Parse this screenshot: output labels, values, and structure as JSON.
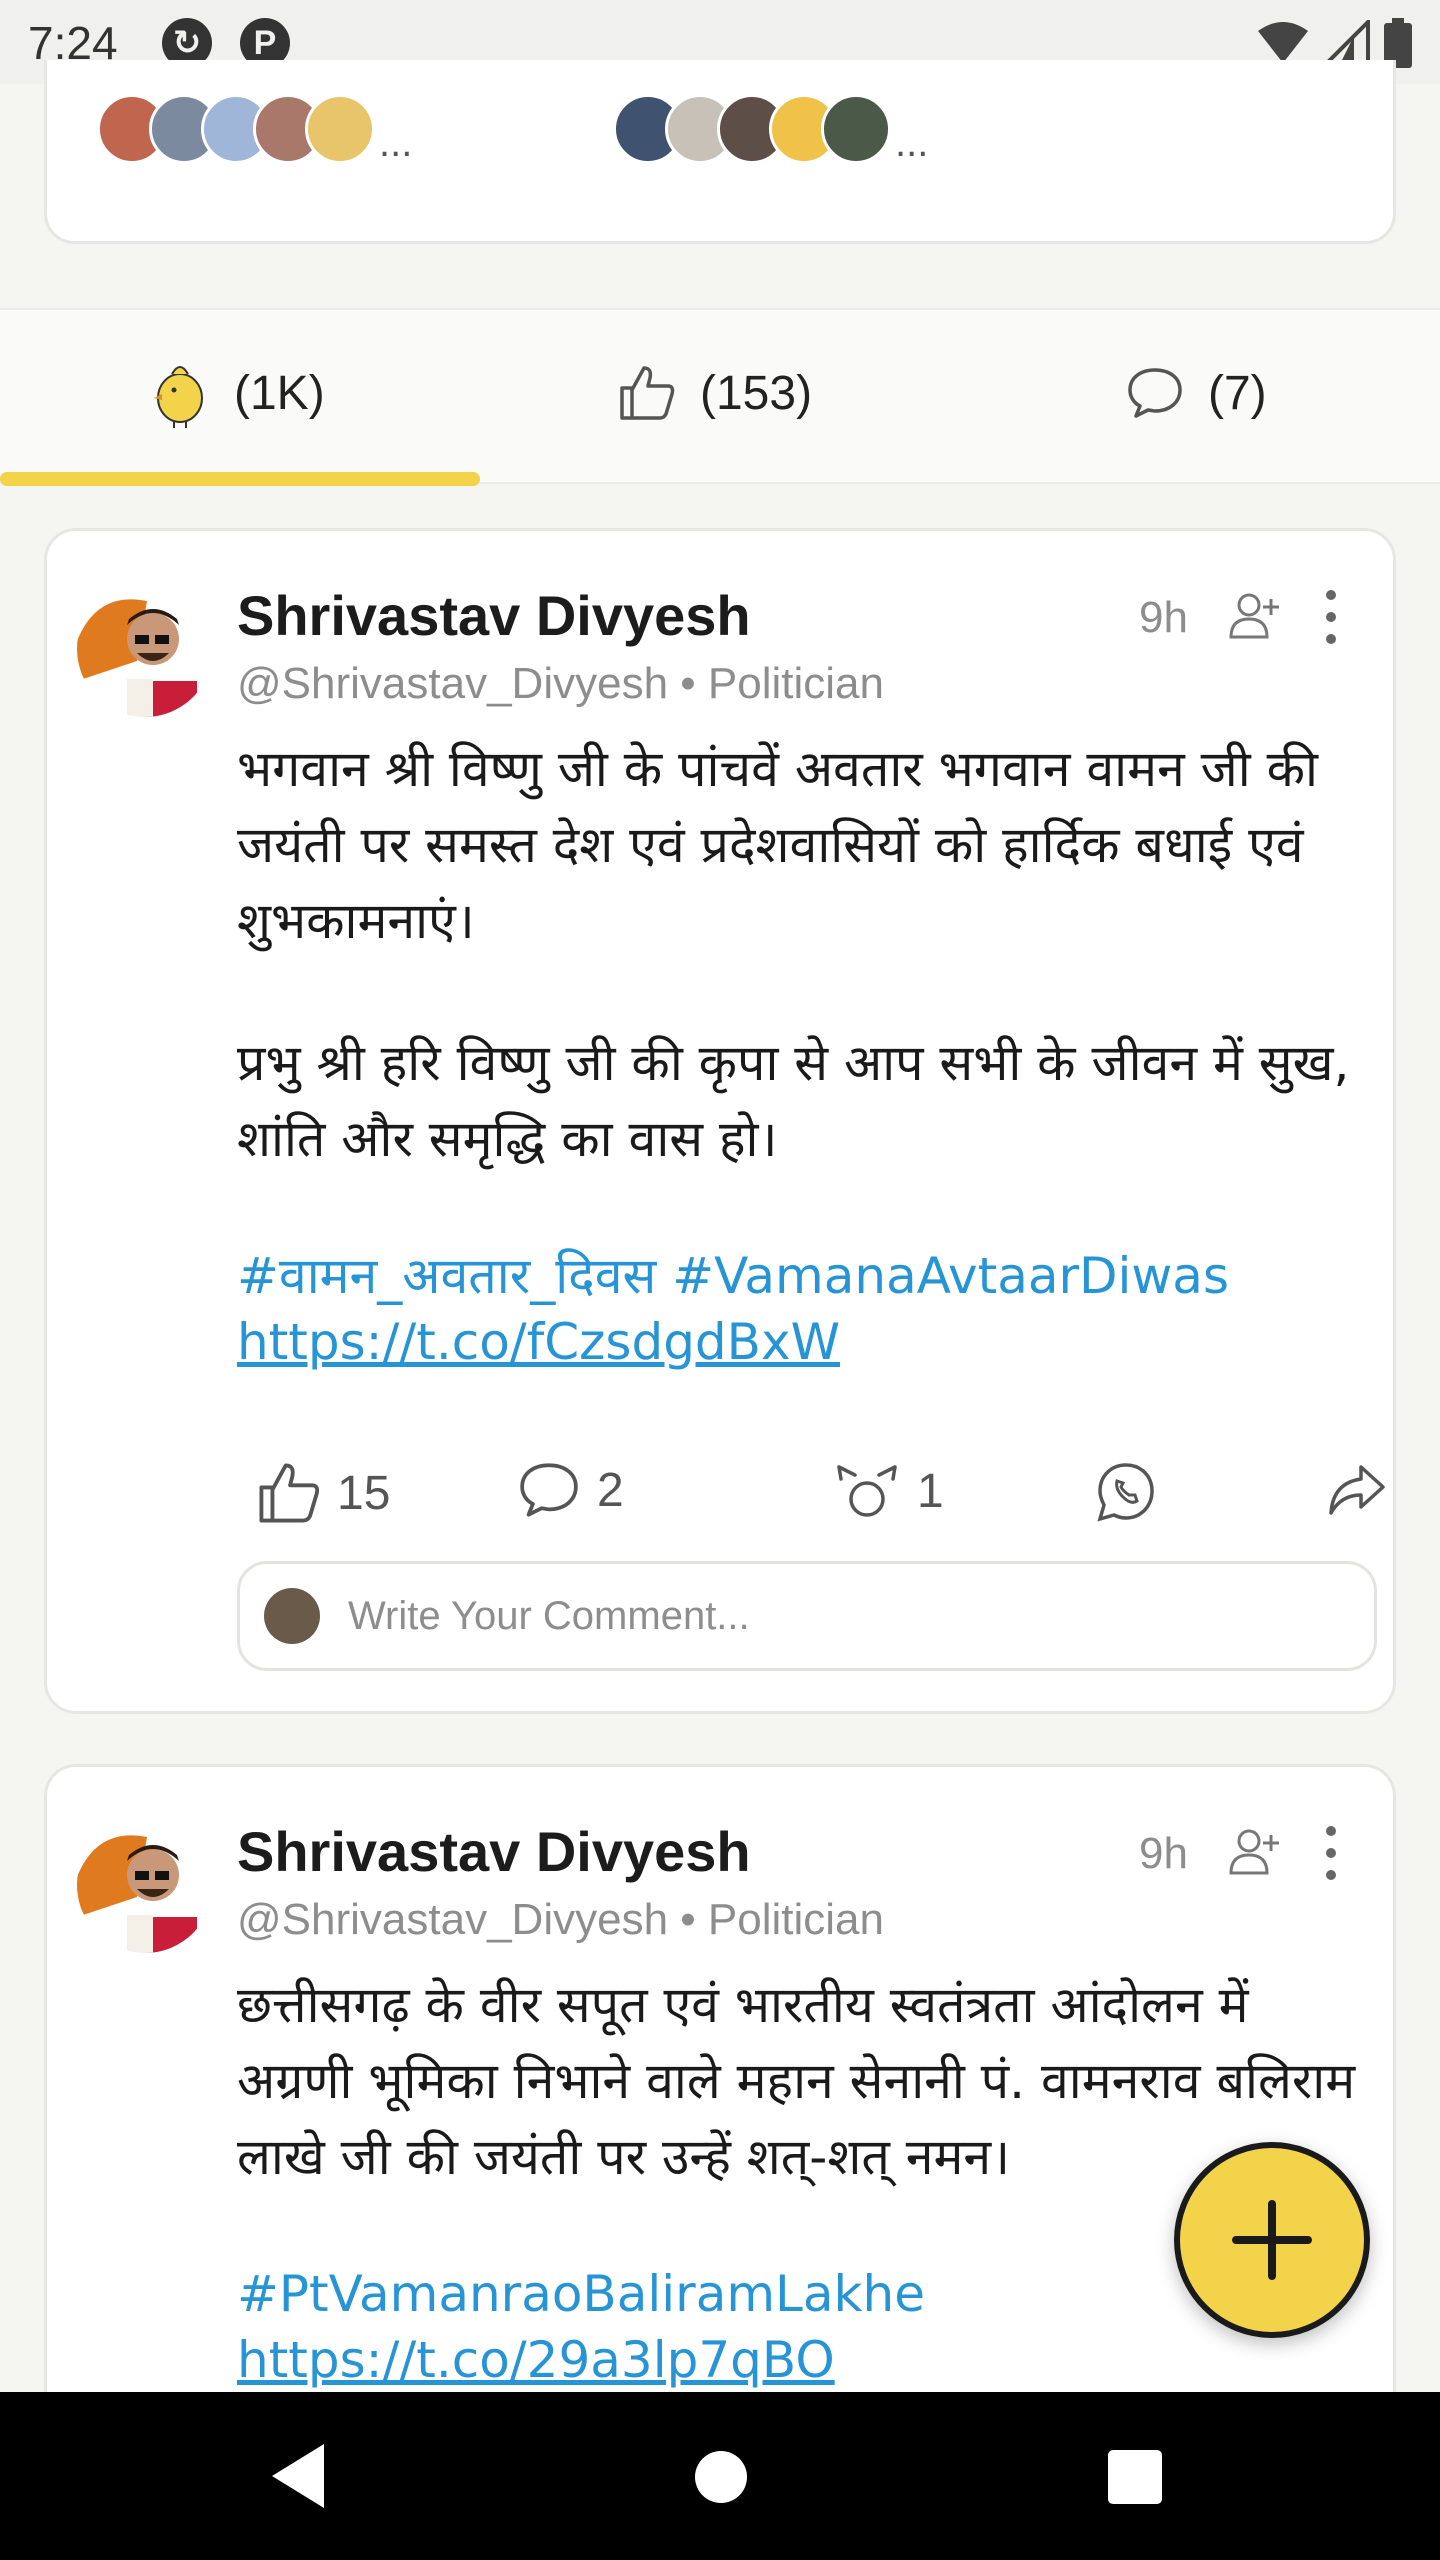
{
  "status_bar": {
    "time": "7:24"
  },
  "top_card": {
    "group1_more": "...",
    "group2_more": "..."
  },
  "tabs": [
    {
      "label": "(1K)",
      "icon": "chick-icon"
    },
    {
      "label": "(153)",
      "icon": "thumbs-up-icon"
    },
    {
      "label": "(7)",
      "icon": "speech-bubble-icon"
    }
  ],
  "colors": {
    "accent": "#f2d34a",
    "link": "#2794d6",
    "muted": "#8d8d8d"
  },
  "posts": [
    {
      "name": "Shrivastav Divyesh",
      "handle": "@Shrivastav_Divyesh",
      "role": "• Politician",
      "time": "9h",
      "body_p1": "भगवान श्री विष्णु जी के पांचवें अवतार भगवान वामन जी की जयंती पर समस्त देश एवं प्रदेशवासियों को हार्दिक बधाई एवं शुभकामनाएं।",
      "body_p2": "प्रभु श्री हरि विष्णु जी की कृपा से आप सभी के जीवन में सुख, शांति और समृद्धि का वास हो।",
      "hashtags": "#वामन_अवतार_दिवस #VamanaAvtaarDiwas",
      "link": "https://t.co/fCzsdgdBxW",
      "likes": "15",
      "comments": "2",
      "shares": "1",
      "comment_placeholder": "Write Your Comment..."
    },
    {
      "name": "Shrivastav Divyesh",
      "handle": "@Shrivastav_Divyesh",
      "role": "• Politician",
      "time": "9h",
      "body_p1": "छत्तीसगढ़ के वीर सपूत एवं भारतीय स्वतंत्रता आंदोलन में अग्रणी भूमिका निभाने वाले महान सेनानी पं. वामनराव बलिराम लाखे जी की जयंती पर उन्हें शत्-शत् नमन।",
      "hashtags": "#PtVamanraoBaliramLakhe",
      "link": "https://t.co/29a3lp7qBO"
    }
  ]
}
